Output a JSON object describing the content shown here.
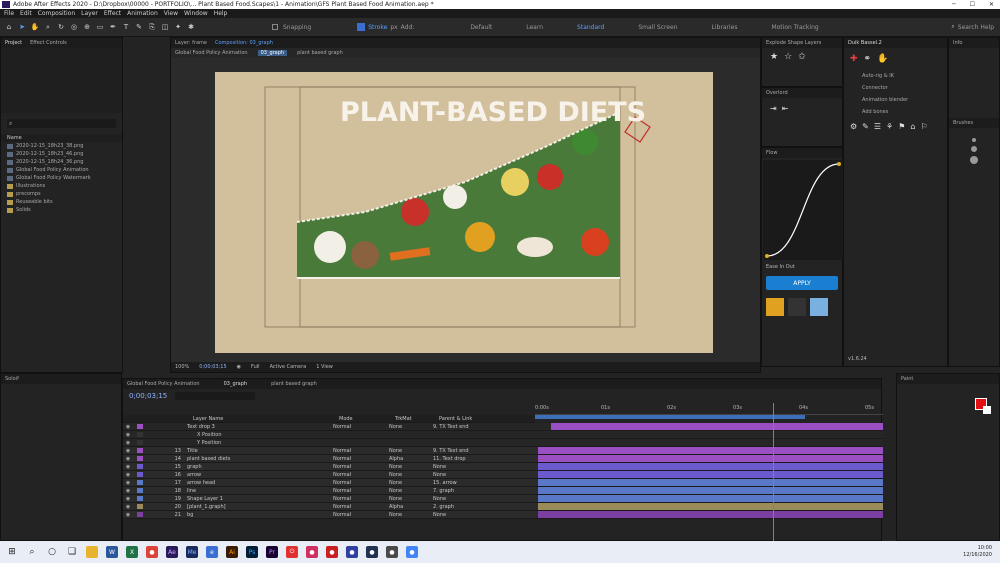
{
  "title_bar": {
    "text": "Adobe After Effects 2020 - D:\\Dropbox\\00000 - PORTFOLIO\\... Plant Based Food.Scapes\\1 - Animation\\GFS Plant Based Food Animation.aep *"
  },
  "menu": [
    "File",
    "Edit",
    "Composition",
    "Layer",
    "Effect",
    "Animation",
    "View",
    "Window",
    "Help"
  ],
  "toolbar": {
    "snapping": "Snapping",
    "stroke": "Stroke",
    "px": "px",
    "add": "Add:"
  },
  "workspaces": [
    "Default",
    "Learn",
    "Standard",
    "Small Screen",
    "Libraries",
    "Motion Tracking"
  ],
  "search_help": "Search Help",
  "project": {
    "tabs": [
      "Project",
      "Effect Controls"
    ],
    "search_placeholder": "",
    "header": "Name",
    "items": [
      {
        "name": "2020-12-15_18h23_38.png",
        "kind": "file"
      },
      {
        "name": "2020-12-15_18h23_46.png",
        "kind": "file"
      },
      {
        "name": "2020-12-15_18h24_36.png",
        "kind": "file"
      },
      {
        "name": "Global Food Policy Animation",
        "kind": "comp"
      },
      {
        "name": "Global Food Policy Watermark",
        "kind": "comp"
      },
      {
        "name": "Illustrations",
        "kind": "folder"
      },
      {
        "name": "precomps",
        "kind": "folder"
      },
      {
        "name": "Reuseable bits",
        "kind": "folder"
      },
      {
        "name": "Solids",
        "kind": "folder"
      }
    ]
  },
  "composition": {
    "tabs": [
      "Layer: frame",
      "Composition: 03_graph"
    ],
    "breadcrumbs": [
      "Global Food Policy Animation",
      "03_graph",
      "plant based graph"
    ],
    "stage_title": "PLANT-BASED DIETS",
    "zoom": "Full",
    "camera": "Active Camera",
    "views": "1 View",
    "timecode": "0;00;03;15"
  },
  "timeline": {
    "tabs": [
      "Global Food Policy Animation",
      "03_graph",
      "plant based graph"
    ],
    "timecode": "0;00;03;15",
    "ruler": [
      "0:00s",
      "01s",
      "02s",
      "03s",
      "04s",
      "05s"
    ],
    "columns": [
      "#",
      "Layer Name",
      "Mode",
      "TrkMat",
      "Parent & Link"
    ],
    "layers": [
      {
        "num": "",
        "name": "Text drop 3",
        "mode": "Normal",
        "trk": "None",
        "parent": "9. TX Text end",
        "color": "#9a4fc2"
      },
      {
        "num": "",
        "name": "X Position",
        "mode": "",
        "trk": "",
        "parent": "",
        "color": "#333"
      },
      {
        "num": "",
        "name": "Y Position",
        "mode": "",
        "trk": "",
        "parent": "",
        "color": "#333"
      },
      {
        "num": "13",
        "name": "Title",
        "mode": "Normal",
        "trk": "None",
        "parent": "9. TX Text end",
        "color": "#9a4fc2"
      },
      {
        "num": "14",
        "name": "plant based diets",
        "mode": "Normal",
        "trk": "Alpha",
        "parent": "11. Text drop",
        "color": "#9a4fc2"
      },
      {
        "num": "15",
        "name": "graph",
        "mode": "Normal",
        "trk": "None",
        "parent": "None",
        "color": "#6a5acd"
      },
      {
        "num": "16",
        "name": "arrow",
        "mode": "Normal",
        "trk": "None",
        "parent": "None",
        "color": "#6a5acd"
      },
      {
        "num": "17",
        "name": "arrow head",
        "mode": "Normal",
        "trk": "None",
        "parent": "15. arrow",
        "color": "#5a78c8"
      },
      {
        "num": "18",
        "name": "line",
        "mode": "Normal",
        "trk": "None",
        "parent": "7. graph",
        "color": "#5a78c8"
      },
      {
        "num": "19",
        "name": "Shape Layer 1",
        "mode": "Normal",
        "trk": "None",
        "parent": "None",
        "color": "#5a78c8"
      },
      {
        "num": "20",
        "name": "[plant_1.graph]",
        "mode": "Normal",
        "trk": "Alpha",
        "parent": "2. graph",
        "color": "#9b8a5a"
      },
      {
        "num": "21",
        "name": "bg",
        "mode": "Normal",
        "trk": "None",
        "parent": "None",
        "color": "#7a3fa0"
      }
    ]
  },
  "right": {
    "tabs_a": [
      "Explode Shape Layers",
      "Duik Bassel.2",
      "Info"
    ],
    "overlord": "Overlord",
    "flow": "Flow",
    "apply": "APPLY",
    "ease": "Ease In Out",
    "paint": "Paint",
    "paint_color": "#e01010",
    "brushes": "Brushes",
    "duik_items": [
      "Auto-rig & IK",
      "Connector",
      "Animation blender",
      "Add bones"
    ],
    "version": "v1.6.24"
  },
  "taskbar": {
    "time": "10:00",
    "date": "12/16/2020"
  }
}
